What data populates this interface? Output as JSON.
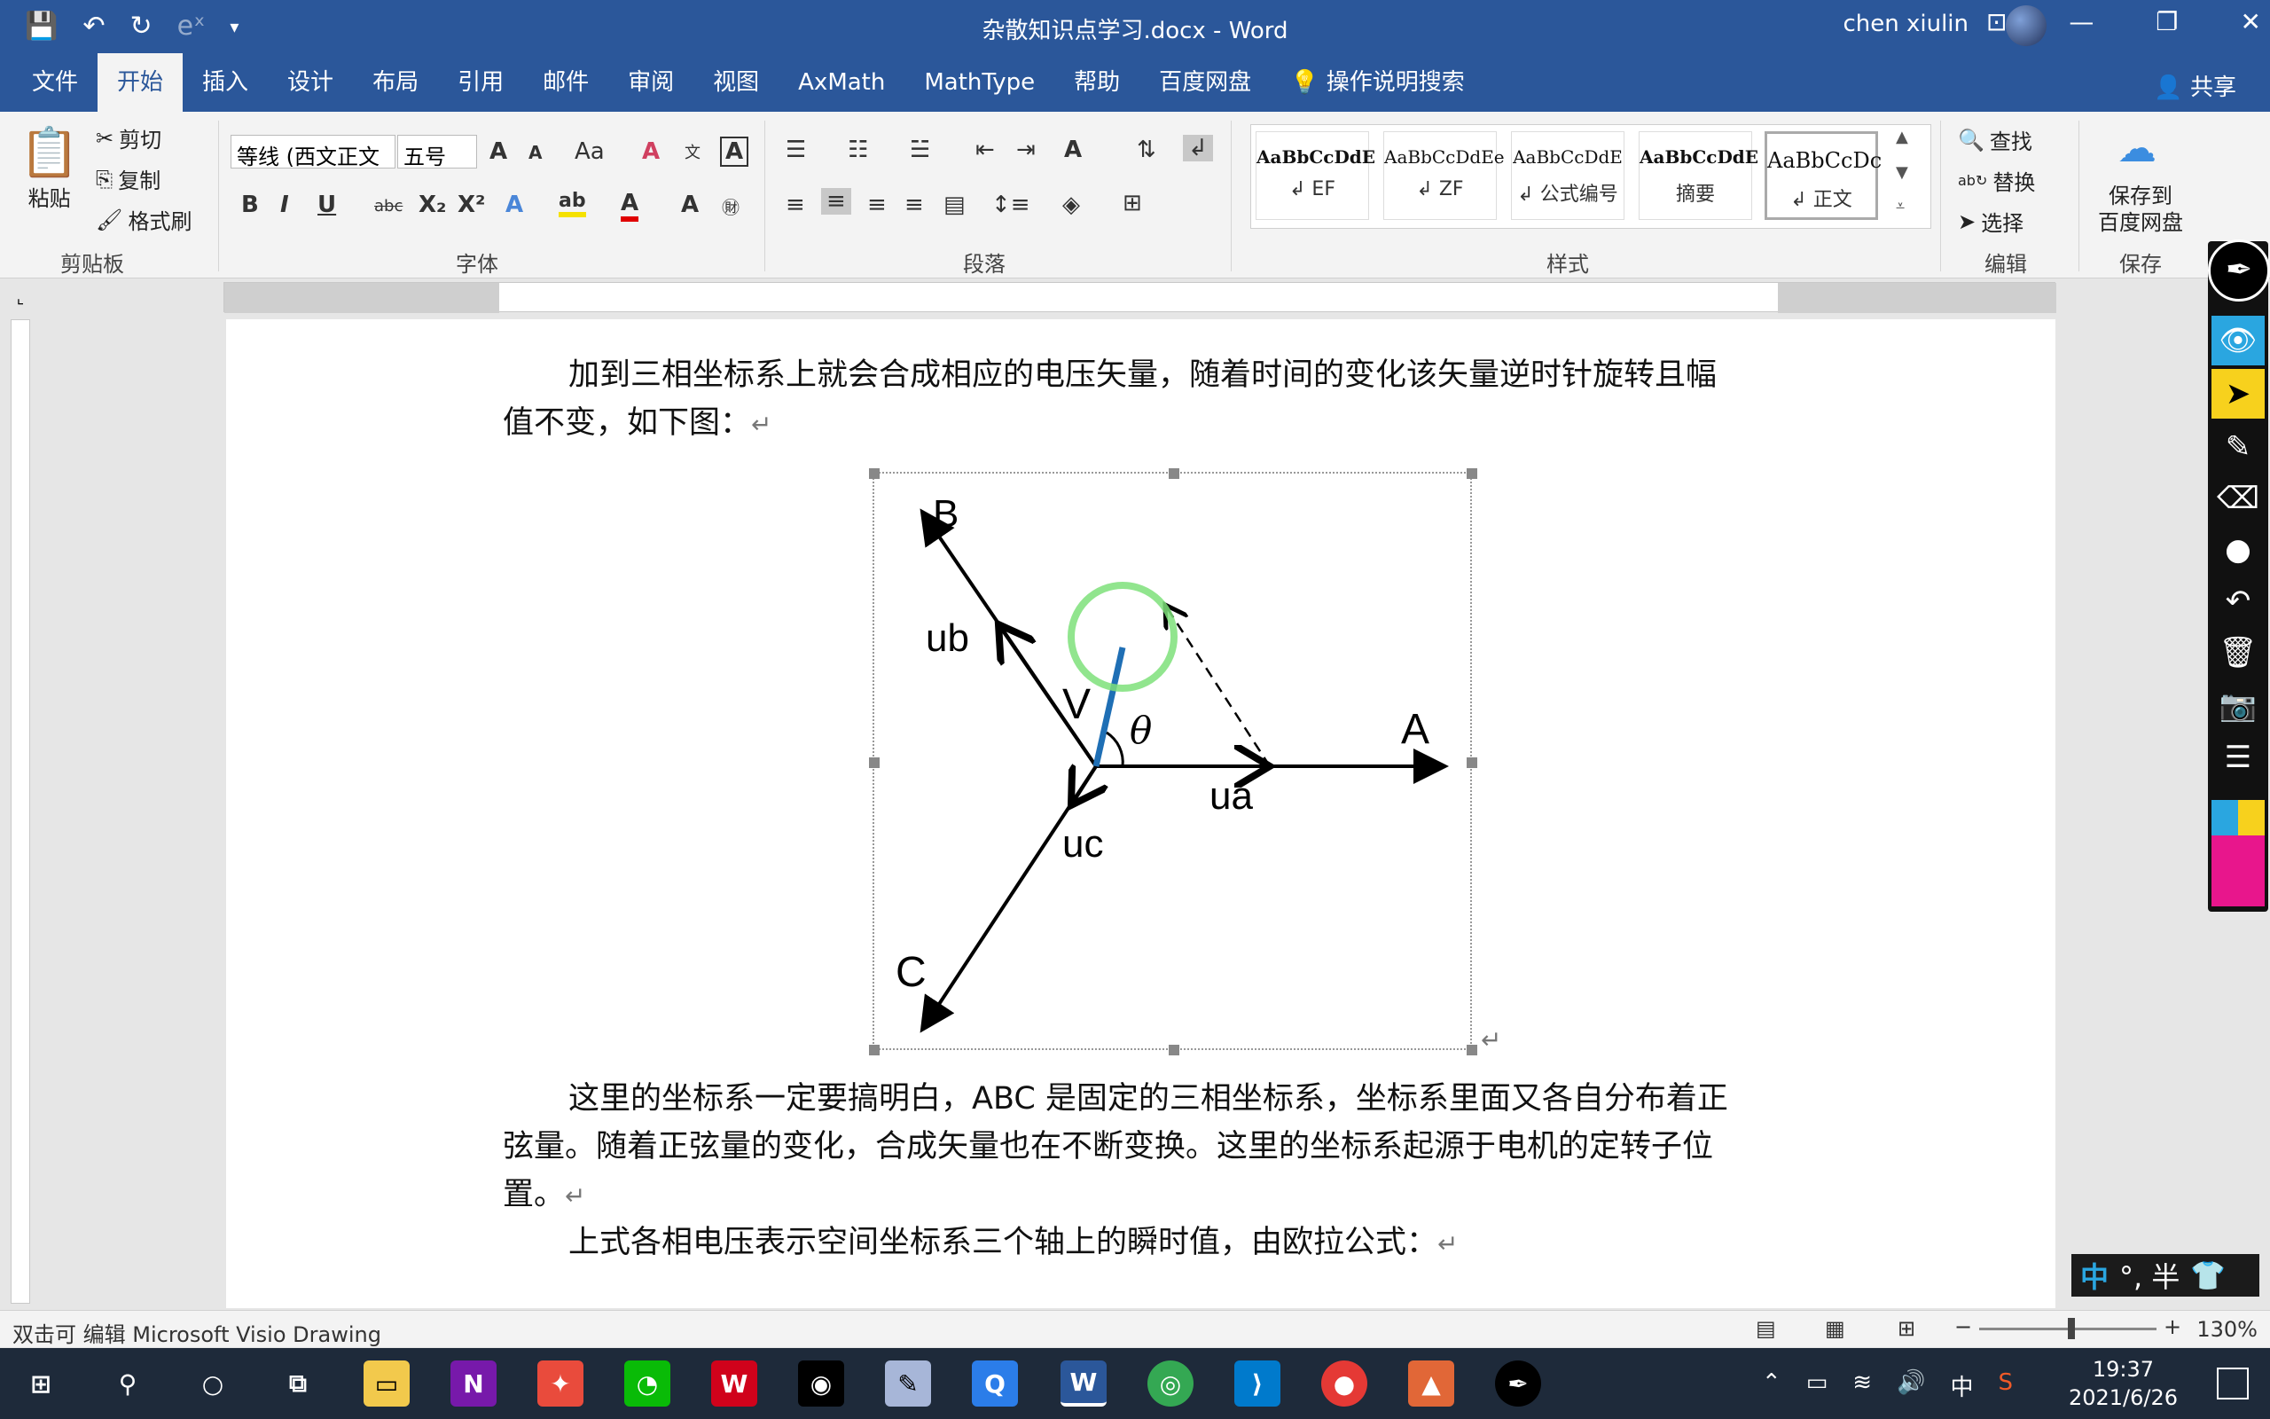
{
  "window": {
    "title": "杂散知识点学习.docx  -  Word",
    "user": "chen xiulin"
  },
  "tabs": [
    "文件",
    "开始",
    "插入",
    "设计",
    "布局",
    "引用",
    "邮件",
    "审阅",
    "视图",
    "AxMath",
    "MathType",
    "帮助",
    "百度网盘"
  ],
  "active_tab": "开始",
  "tell_me": "操作说明搜索",
  "share": "共享",
  "clipboard": {
    "paste": "粘贴",
    "cut": "剪切",
    "copy": "复制",
    "format_painter": "格式刷",
    "label": "剪贴板"
  },
  "font": {
    "name": "等线 (西文正文",
    "size": "五号",
    "label": "字体"
  },
  "paragraph": {
    "label": "段落"
  },
  "styles": {
    "label": "样式",
    "items": [
      {
        "sample": "AaBbCcDdE",
        "name": "↲ EF"
      },
      {
        "sample": "AaBbCcDdEe",
        "name": "↲ ZF"
      },
      {
        "sample": "AaBbCcDdE",
        "name": "↲ 公式编号"
      },
      {
        "sample": "AaBbCcDdE",
        "name": "摘要"
      },
      {
        "sample": "AaBbCcDc",
        "name": "↲ 正文"
      }
    ]
  },
  "editing": {
    "find": "查找",
    "replace": "替换",
    "select": "选择",
    "label": "编辑"
  },
  "save_group": {
    "button": "保存到\n百度网盘",
    "label": "保存"
  },
  "document": {
    "para1_line1": "加到三相坐标系上就会合成相应的电压矢量，随着时间的变化该矢量逆时针旋转且幅",
    "para1_line2": "值不变，如下图：",
    "para2_line1": "这里的坐标系一定要搞明白，ABC 是固定的三相坐标系，坐标系里面又各自分布着正",
    "para2_line2": "弦量。随着正弦量的变化，合成矢量也在不断变换。这里的坐标系起源于电机的定转子位",
    "para2_line3": "置。",
    "para3": "上式各相电压表示空间坐标系三个轴上的瞬时值，由欧拉公式：",
    "pilcrow": "↵"
  },
  "diagram": {
    "label_A": "A",
    "label_B": "B",
    "label_C": "C",
    "label_ua": "ua",
    "label_ub": "ub",
    "label_uc": "uc",
    "label_V": "V",
    "label_theta": "θ",
    "colors": {
      "axis": "#000000",
      "vector": "#1f6fb5",
      "highlight": "#7ee07a"
    }
  },
  "ime": {
    "mode": "中",
    "extra": "°, 半"
  },
  "statusbar": {
    "left": "双击可 编辑 Microsoft Visio Drawing",
    "zoom": "130%"
  },
  "taskbar": {
    "time": "19:37",
    "date": "2021/6/26",
    "ime": "中"
  }
}
